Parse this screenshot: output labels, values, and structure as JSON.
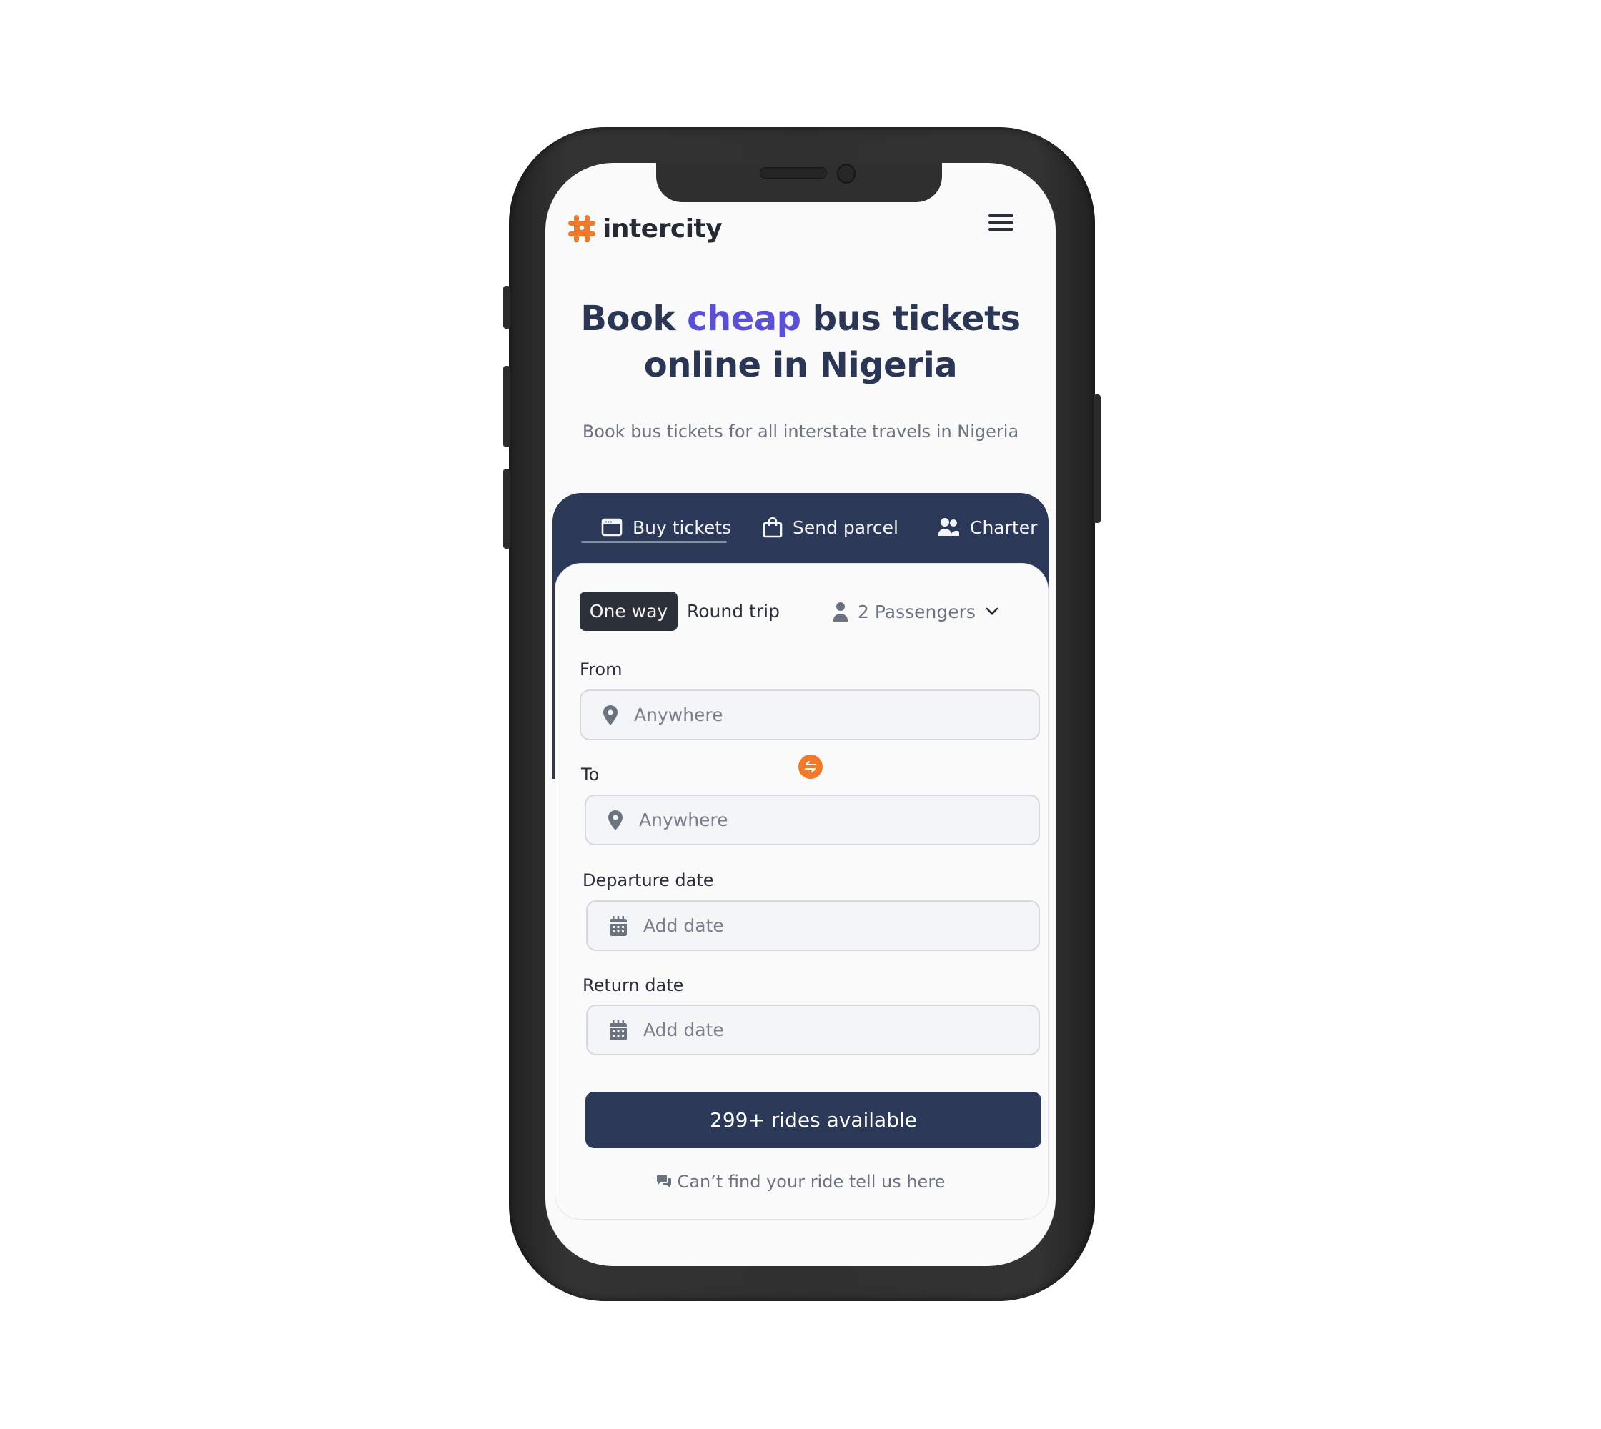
{
  "brand": {
    "name": "intercity",
    "accent_color": "#f07a2b"
  },
  "hero": {
    "title_before": "Book ",
    "title_accent": "cheap",
    "title_after": " bus tickets",
    "title_line2": "online in Nigeria",
    "subtitle": "Book bus tickets for all interstate travels in Nigeria",
    "accent_color": "#5b4fd3"
  },
  "tabs": [
    {
      "label": "Buy tickets",
      "icon": "ticket-window-icon",
      "active": true
    },
    {
      "label": "Send parcel",
      "icon": "shopping-bag-icon",
      "active": false
    },
    {
      "label": "Charter",
      "icon": "users-icon",
      "active": false
    }
  ],
  "trip_type": {
    "options": [
      "One way",
      "Round trip"
    ],
    "selected": "One way"
  },
  "passengers": {
    "label": "2 Passengers",
    "count": 2
  },
  "form": {
    "from": {
      "label": "From",
      "placeholder": "Anywhere"
    },
    "to": {
      "label": "To",
      "placeholder": "Anywhere"
    },
    "departure": {
      "label": "Departure date",
      "placeholder": "Add date"
    },
    "return": {
      "label": "Return date",
      "placeholder": "Add date"
    }
  },
  "cta": {
    "label": "299+ rides available"
  },
  "help": {
    "label": "Can’t find your ride tell us here"
  },
  "colors": {
    "navy": "#2c3858",
    "dark": "#2c3038",
    "orange": "#f07a2b",
    "purple": "#5b4fd3"
  }
}
